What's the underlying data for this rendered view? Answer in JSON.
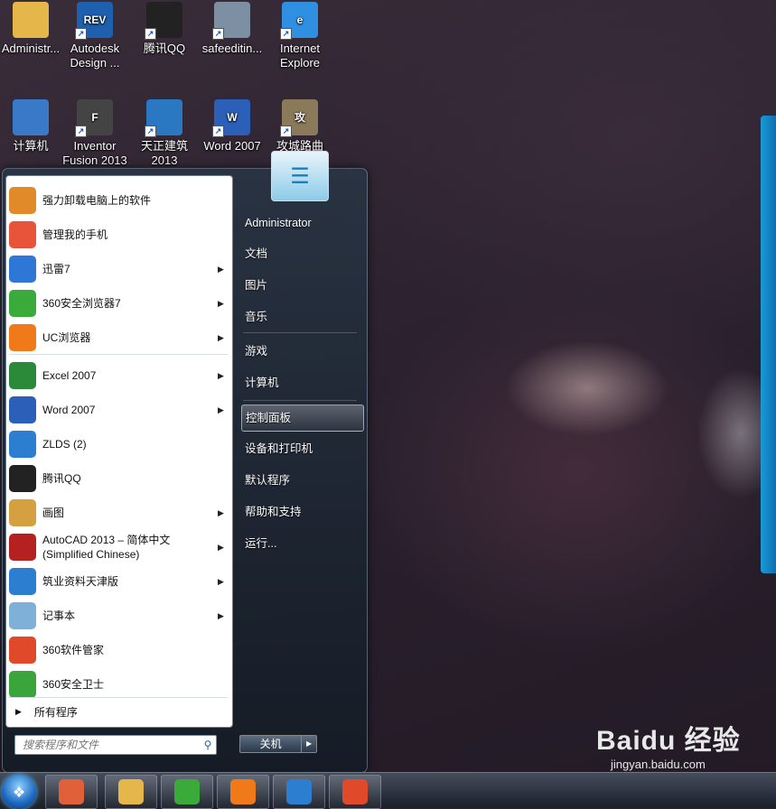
{
  "desktop": {
    "icons": [
      {
        "label": "Administr...",
        "name": "desktop-icon-administrator",
        "glyph_color": "#e5b64a"
      },
      {
        "label": "Autodesk Design ...",
        "name": "desktop-icon-autodesk-design-review",
        "glyph_color": "#1e5fae",
        "glyph_text": "REV"
      },
      {
        "label": "腾讯QQ",
        "name": "desktop-icon-qq",
        "glyph_color": "#222222"
      },
      {
        "label": "safeeditin...",
        "name": "desktop-icon-safeediting",
        "glyph_color": "#7d8fa2"
      },
      {
        "label": "Internet Explore",
        "name": "desktop-icon-internet-explorer",
        "glyph_color": "#2f8fe0",
        "glyph_text": "e"
      },
      {
        "label": "计算机",
        "name": "desktop-icon-computer",
        "glyph_color": "#3a78c8"
      },
      {
        "label": "Inventor Fusion 2013",
        "name": "desktop-icon-inventor-fusion",
        "glyph_color": "#444444",
        "glyph_text": "F"
      },
      {
        "label": "天正建筑 2013",
        "name": "desktop-icon-tangent-arch",
        "glyph_color": "#2a78c2"
      },
      {
        "label": "Word 2007",
        "name": "desktop-icon-word-2007",
        "glyph_color": "#2b5fb8",
        "glyph_text": "W"
      },
      {
        "label": "攻城路曲",
        "name": "desktop-icon-game",
        "glyph_color": "#8a7a5a",
        "glyph_text": "攻"
      }
    ]
  },
  "start_menu": {
    "programs": [
      {
        "label": "强力卸载电脑上的软件",
        "has_arrow": false,
        "icon": "uninstall-icon",
        "color": "#e08a2a"
      },
      {
        "label": "管理我的手机",
        "has_arrow": false,
        "icon": "phone-manager-icon",
        "color": "#e8543a"
      },
      {
        "label": "迅雷7",
        "has_arrow": true,
        "icon": "xunlei-icon",
        "color": "#2f77d6"
      },
      {
        "label": "360安全浏览器7",
        "has_arrow": true,
        "icon": "360-browser-icon",
        "color": "#3aaa3a"
      },
      {
        "label": "UC浏览器",
        "has_arrow": true,
        "icon": "uc-browser-icon",
        "color": "#f07a1a"
      },
      {
        "label": "Excel 2007",
        "has_arrow": true,
        "icon": "excel-icon",
        "color": "#2a8a3a"
      },
      {
        "label": "Word 2007",
        "has_arrow": true,
        "icon": "word-icon",
        "color": "#2b5fb8"
      },
      {
        "label": "ZLDS (2)",
        "has_arrow": false,
        "icon": "zlds-icon",
        "color": "#2c7fd0"
      },
      {
        "label": "腾讯QQ",
        "has_arrow": false,
        "icon": "qq-icon",
        "color": "#222222"
      },
      {
        "label": "画图",
        "has_arrow": true,
        "icon": "paint-icon",
        "color": "#d4a040"
      },
      {
        "label": "AutoCAD 2013 – 简体中文 (Simplified Chinese)",
        "has_arrow": true,
        "icon": "autocad-icon",
        "color": "#b52020"
      },
      {
        "label": "筑业资料天津版",
        "has_arrow": true,
        "icon": "zhuye-icon",
        "color": "#2c7fd0"
      },
      {
        "label": "记事本",
        "has_arrow": true,
        "icon": "notepad-icon",
        "color": "#7fb0d8"
      },
      {
        "label": "360软件管家",
        "has_arrow": false,
        "icon": "360-software-icon",
        "color": "#e04a2a"
      },
      {
        "label": "360安全卫士",
        "has_arrow": false,
        "icon": "360-safe-icon",
        "color": "#3aa53a"
      }
    ],
    "all_programs": "所有程序",
    "search_placeholder": "搜索程序和文件",
    "user_name": "Administrator",
    "right_links": [
      {
        "label": "文档",
        "name": "start-link-documents"
      },
      {
        "label": "图片",
        "name": "start-link-pictures"
      },
      {
        "label": "音乐",
        "name": "start-link-music"
      },
      {
        "label": "游戏",
        "name": "start-link-games"
      },
      {
        "label": "计算机",
        "name": "start-link-computer"
      },
      {
        "label": "控制面板",
        "name": "start-link-control-panel",
        "highlighted": true
      },
      {
        "label": "设备和打印机",
        "name": "start-link-devices-printers"
      },
      {
        "label": "默认程序",
        "name": "start-link-default-programs"
      },
      {
        "label": "帮助和支持",
        "name": "start-link-help-support"
      },
      {
        "label": "运行...",
        "name": "start-link-run"
      }
    ],
    "shutdown_label": "关机"
  },
  "taskbar": {
    "buttons": [
      {
        "name": "taskbar-button-pinwheel",
        "color": "#e0603a"
      },
      {
        "name": "taskbar-button-explorer",
        "color": "#e5b64a"
      },
      {
        "name": "taskbar-button-360-browser",
        "color": "#3aaa3a"
      },
      {
        "name": "taskbar-button-uc-browser",
        "color": "#f07a1a"
      },
      {
        "name": "taskbar-button-zlds",
        "color": "#2c7fd0"
      },
      {
        "name": "taskbar-button-360-app",
        "color": "#e04a2a"
      }
    ]
  },
  "watermark": {
    "logo": "Baidu 经验",
    "url": "jingyan.baidu.com"
  }
}
